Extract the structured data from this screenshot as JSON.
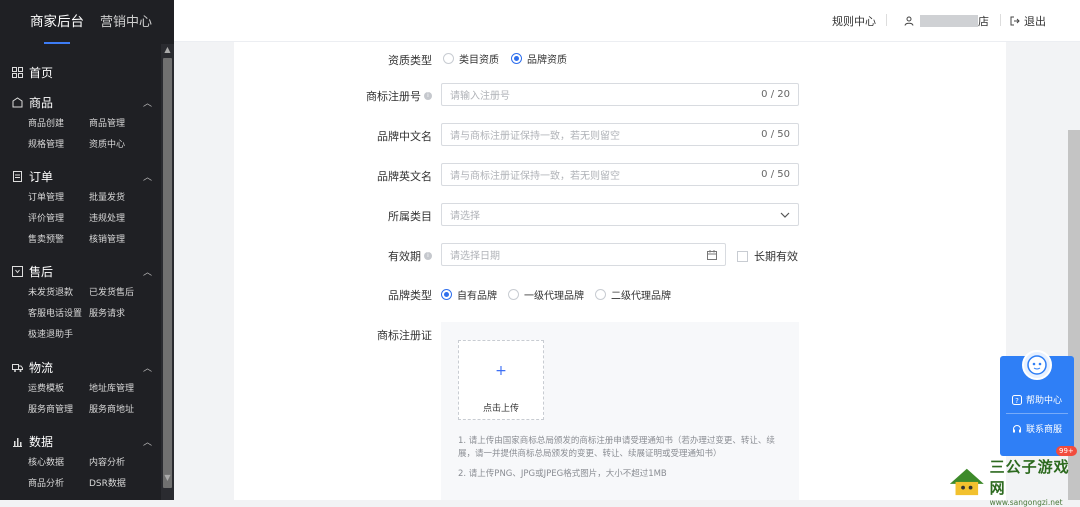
{
  "sidebar": {
    "tabs": [
      "商家后台",
      "营销中心"
    ],
    "home": "首页",
    "groups": [
      {
        "title": "商品",
        "items": [
          "商品创建",
          "商品管理",
          "规格管理",
          "资质中心"
        ]
      },
      {
        "title": "订单",
        "items": [
          "订单管理",
          "批量发货",
          "评价管理",
          "违规处理",
          "售卖预警",
          "核销管理"
        ]
      },
      {
        "title": "售后",
        "items": [
          "未发货退款",
          "已发货售后",
          "客服电话设置",
          "服务请求",
          "极速退助手"
        ]
      },
      {
        "title": "物流",
        "items": [
          "运费模板",
          "地址库管理",
          "服务商管理",
          "服务商地址"
        ]
      },
      {
        "title": "数据",
        "items": [
          "核心数据",
          "内容分析",
          "商品分析",
          "DSR数据"
        ]
      }
    ]
  },
  "topbar": {
    "rule_center": "规则中心",
    "shop_suffix": "店",
    "logout": "退出"
  },
  "form": {
    "qualification_type": {
      "label": "资质类型",
      "options": [
        "类目资质",
        "品牌资质"
      ],
      "selected": 1
    },
    "trademark_no": {
      "label": "商标注册号",
      "placeholder": "请输入注册号",
      "count": "0 / 20"
    },
    "brand_cn": {
      "label": "品牌中文名",
      "placeholder": "请与商标注册证保持一致，若无则留空",
      "count": "0 / 50"
    },
    "brand_en": {
      "label": "品牌英文名",
      "placeholder": "请与商标注册证保持一致，若无则留空",
      "count": "0 / 50"
    },
    "category": {
      "label": "所属类目",
      "placeholder": "请选择"
    },
    "validity": {
      "label": "有效期",
      "placeholder": "请选择日期",
      "long_term": "长期有效"
    },
    "brand_type": {
      "label": "品牌类型",
      "options": [
        "自有品牌",
        "一级代理品牌",
        "二级代理品牌"
      ],
      "selected": 0
    },
    "certificate": {
      "label": "商标注册证",
      "upload_text": "点击上传",
      "note1": "1. 请上传由国家商标总局颁发的商标注册申请受理通知书（若办理过变更、转让、续展，请一并提供商标总局颁发的变更、转让、续展证明或受理通知书）",
      "note2": "2. 请上传PNG、JPG或JPEG格式图片，大小不超过1MB"
    }
  },
  "help_widget": {
    "help_center": "帮助中心",
    "contact": "联系商服",
    "badge": "99+"
  },
  "watermark": {
    "title": "三公子游戏网",
    "url": "www.sangongzi.net"
  }
}
